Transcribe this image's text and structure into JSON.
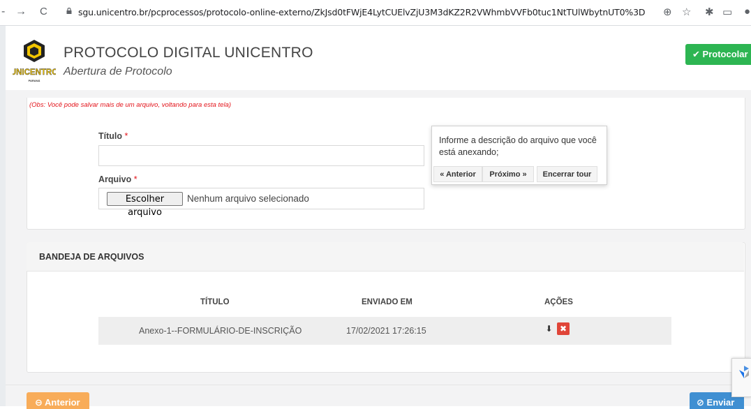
{
  "browser": {
    "url": "sgu.unicentro.br/pcprocessos/protocolo-online-externo/ZkJsd0tFWjE4LytCUElvZjU3M3dKZ2R2VWhmbVVFb0tuc1NtTUlWbytnUT0%3D"
  },
  "header": {
    "logo_text": "UNICENTRO",
    "logo_sub": "PARANÁ",
    "title": "PROTOCOLO DIGITAL UNICENTRO",
    "subtitle": "Abertura de Protocolo",
    "protocolar_label": "Protocolar"
  },
  "form": {
    "obs": "(Obs: Você pode salvar mais de um arquivo, voltando para esta tela)",
    "titulo_label": "Título",
    "arquivo_label": "Arquivo",
    "required_mark": "*",
    "titulo_value": "",
    "file_button": "Escolher arquivo",
    "file_status": "Nenhum arquivo selecionado"
  },
  "tour": {
    "text": "Informe a descrição do arquivo que você está anexando;",
    "prev": "« Anterior",
    "next": "Próximo »",
    "end": "Encerrar tour"
  },
  "bandeja": {
    "title": "BANDEJA DE ARQUIVOS",
    "columns": [
      "TÍTULO",
      "ENVIADO EM",
      "AÇÕES"
    ],
    "rows": [
      {
        "titulo": "Anexo-1--FORMULÁRIO-DE-INSCRIÇÃO",
        "enviado_em": "17/02/2021 17:26:15"
      }
    ]
  },
  "footer": {
    "anterior_label": "Anterior",
    "enviar_label": "Enviar"
  },
  "colors": {
    "green": "#2db552",
    "orange": "#f8ac59",
    "blue": "#3f8fd2",
    "red": "#e3141b"
  }
}
